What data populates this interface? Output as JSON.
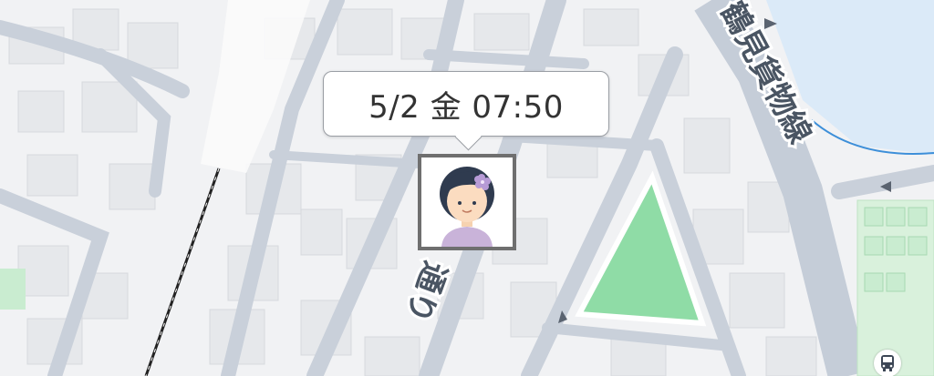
{
  "map": {
    "time_popup": "5/2 金 07:50",
    "labels": {
      "road_right": "鶴見貨物線",
      "road_center": "通り"
    },
    "markers": {
      "person": "person-avatar",
      "bus": "bus-stop-icon"
    },
    "colors": {
      "background": "#f1f2f4",
      "block": "#e4e6ea",
      "road": "#c9d0da",
      "park": "#8fdca6",
      "water": "#dbeaf8",
      "label": "#4a5563"
    }
  }
}
